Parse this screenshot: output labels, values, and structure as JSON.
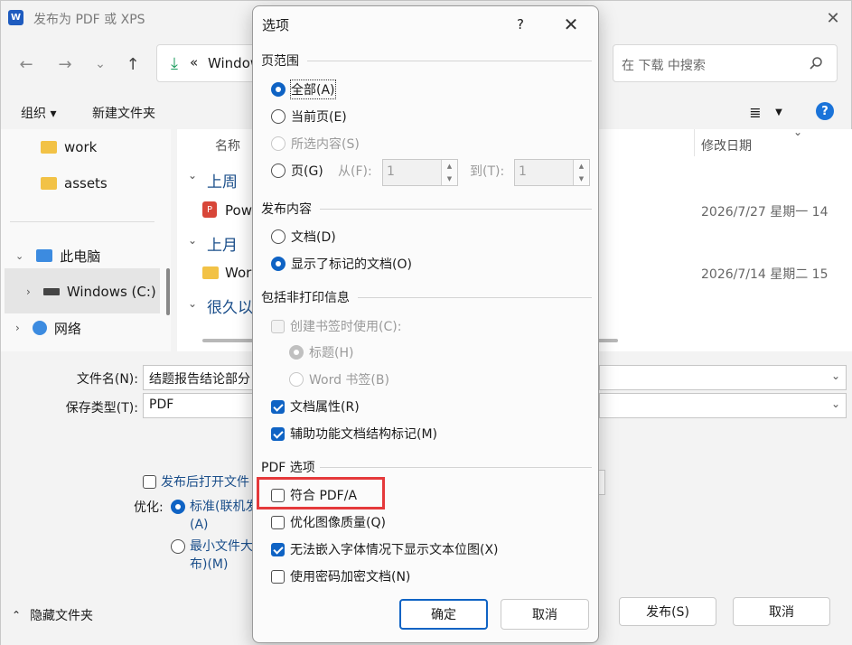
{
  "background_window": {
    "title": "发布为 PDF 或 XPS",
    "app_icon_letter": "W",
    "close_glyph": "✕",
    "address": {
      "prefix": "«",
      "text": "Window"
    },
    "search_placeholder": "在 下载 中搜索",
    "toolbar": {
      "organize": "组织 ▾",
      "new_folder": "新建文件夹"
    },
    "nav_tree": [
      {
        "label": "work",
        "type": "folder"
      },
      {
        "label": "assets",
        "type": "folder"
      },
      {
        "label": "此电脑",
        "type": "pc"
      },
      {
        "label": "Windows (C:)",
        "type": "drive"
      },
      {
        "label": "网络",
        "type": "network"
      }
    ],
    "columns": {
      "name": "名称",
      "modified": "修改日期"
    },
    "groups": [
      {
        "header": "上周",
        "file": "Pow",
        "date": "2026/7/27 星期一 14"
      },
      {
        "header": "上月",
        "file": "Wor",
        "date": "2026/7/14 星期二 15"
      },
      {
        "header": "很久以",
        "file": "",
        "date": ""
      }
    ],
    "filename_label": "文件名(N):",
    "filename_value": "结题报告结论部分",
    "filetype_label": "保存类型(T):",
    "filetype_value": "PDF",
    "open_after": "发布后打开文件",
    "optimize_label": "优化:",
    "opt_standard_line1": "标准(联机发",
    "opt_standard_line2": "(A)",
    "opt_min_line1": "最小文件大",
    "opt_min_line2": "布)(M)",
    "hide_folders": "隐藏文件夹",
    "publish_button": "发布(S)",
    "cancel_button": "取消"
  },
  "dialog": {
    "title": "选项",
    "help_glyph": "?",
    "close_glyph": "✕",
    "page_range": {
      "title": "页范围",
      "all": "全部(A)",
      "current": "当前页(E)",
      "selection": "所选内容(S)",
      "pages": "页(G)",
      "from_label": "从(F):",
      "from_value": "1",
      "to_label": "到(T):",
      "to_value": "1"
    },
    "publish_content": {
      "title": "发布内容",
      "document": "文档(D)",
      "document_markup": "显示了标记的文档(O)"
    },
    "non_print": {
      "title": "包括非打印信息",
      "create_bookmarks": "创建书签时使用(C):",
      "headings": "标题(H)",
      "word_bookmarks": "Word 书签(B)",
      "doc_properties": "文档属性(R)",
      "accessibility_tags": "辅助功能文档结构标记(M)"
    },
    "pdf_options": {
      "title": "PDF 选项",
      "pdfa": "符合 PDF/A",
      "optimize_images": "优化图像质量(Q)",
      "bitmap_text": "无法嵌入字体情况下显示文本位图(X)",
      "encrypt": "使用密码加密文档(N)"
    },
    "ok_button": "确定",
    "cancel_button": "取消"
  }
}
